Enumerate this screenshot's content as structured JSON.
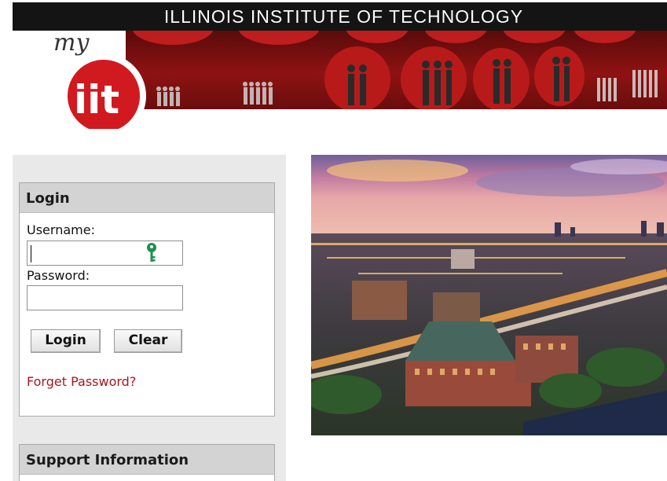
{
  "header": {
    "institution_title": "ILLINOIS INSTITUTE OF TECHNOLOGY",
    "logo_text_my": "my",
    "logo_text_iit": "iit"
  },
  "login_panel": {
    "title": "Login",
    "username_label": "Username:",
    "username_value": "",
    "password_label": "Password:",
    "password_value": "",
    "login_button": "Login",
    "clear_button": "Clear",
    "forgot_password_link": "Forget Password?"
  },
  "support_panel": {
    "title": "Support Information"
  },
  "icons": {
    "key": "key-icon",
    "logo": "myiit-logo"
  },
  "colors": {
    "header_bar": "#141414",
    "banner_red": "#8e1212",
    "logo_red": "#d11920",
    "link_red": "#a8161b",
    "key_green": "#1f8f4f",
    "panel_header": "#d3d3d3",
    "sidebar_bg": "#e9e9e9"
  }
}
